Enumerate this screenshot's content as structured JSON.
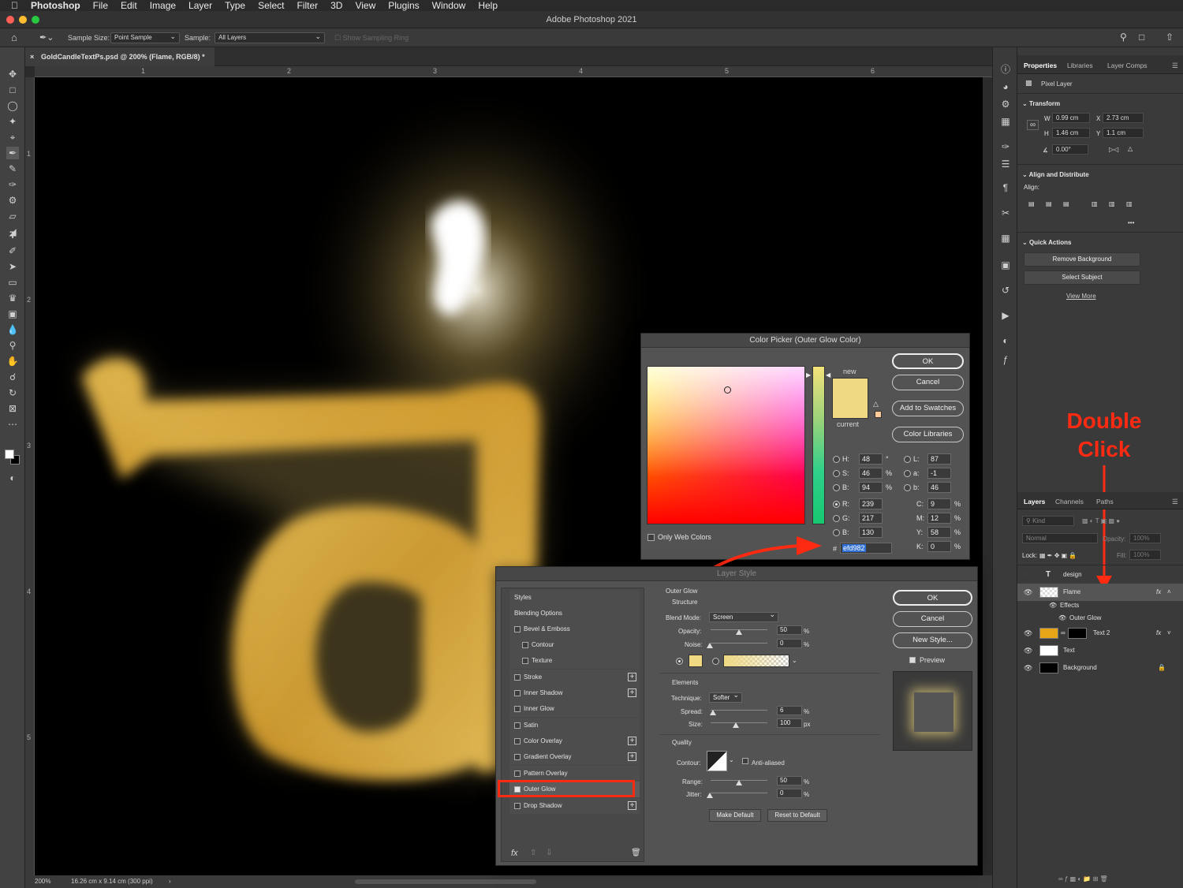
{
  "menubar": {
    "app": "Photoshop",
    "items": [
      "File",
      "Edit",
      "Image",
      "Layer",
      "Type",
      "Select",
      "Filter",
      "3D",
      "View",
      "Plugins",
      "Window",
      "Help"
    ]
  },
  "window_title": "Adobe Photoshop 2021",
  "options": {
    "sample_size_label": "Sample Size:",
    "sample_size_value": "Point Sample",
    "sample_label": "Sample:",
    "sample_value": "All Layers",
    "show_ring": "Show Sampling Ring"
  },
  "document": {
    "tab_title": "GoldCandleTextPs.psd @ 200% (Flame, RGB/8) *",
    "ruler_h": [
      "1",
      "2",
      "3",
      "4",
      "5",
      "6"
    ],
    "ruler_v": [
      "1",
      "2",
      "3",
      "4",
      "5"
    ],
    "zoom": "200%",
    "doc_size": "16.26 cm x 9.14 cm (300 ppi)",
    "status_arrow": "›"
  },
  "properties": {
    "tabs": [
      "Properties",
      "Libraries",
      "Layer Comps"
    ],
    "pixel_layer": "Pixel Layer",
    "transform_title": "Transform",
    "w_label": "W",
    "w": "0.99 cm",
    "x_label": "X",
    "x": "2.73 cm",
    "h_label": "H",
    "h": "1.46 cm",
    "y_label": "Y",
    "y": "1.1 cm",
    "angle": "0.00°",
    "align_title": "Align and Distribute",
    "align_label": "Align:",
    "more": "•••",
    "quick_title": "Quick Actions",
    "remove_bg": "Remove Background",
    "select_subject": "Select Subject",
    "view_more": "View More"
  },
  "layers_panel": {
    "tabs": [
      "Layers",
      "Channels",
      "Paths"
    ],
    "kind_placeholder": "Kind",
    "blend": "Normal",
    "opacity_label": "Opacity:",
    "opacity": "100%",
    "lock_label": "Lock:",
    "fill_label": "Fill:",
    "fill": "100%",
    "layers": [
      {
        "name": "design",
        "type": "text"
      },
      {
        "name": "Flame",
        "fx": "fx"
      },
      {
        "name": "Effects"
      },
      {
        "name": "Outer Glow"
      },
      {
        "name": "Text 2",
        "fx": "fx"
      },
      {
        "name": "Text"
      },
      {
        "name": "Background"
      }
    ]
  },
  "annotation": {
    "line1": "Double",
    "line2": "Click",
    "color": "#ff2a12"
  },
  "color_picker": {
    "title": "Color Picker (Outer Glow Color)",
    "ok": "OK",
    "cancel": "Cancel",
    "add_swatches": "Add to Swatches",
    "color_libraries": "Color Libraries",
    "new_label": "new",
    "current_label": "current",
    "new_color": "#efd982",
    "current_color": "#efd982",
    "h_label": "H:",
    "h": "48",
    "h_unit": "°",
    "s_label": "S:",
    "s": "46",
    "s_unit": "%",
    "b_label": "B:",
    "b": "94",
    "b_unit": "%",
    "r_label": "R:",
    "r": "239",
    "g_label": "G:",
    "g": "217",
    "bl_label": "B:",
    "bl": "130",
    "l_label": "L:",
    "l": "87",
    "a_label": "a:",
    "a": "-1",
    "b2_label": "b:",
    "b2": "46",
    "c_label": "C:",
    "c": "9",
    "m_label": "M:",
    "m": "12",
    "yy_label": "Y:",
    "yy": "58",
    "k_label": "K:",
    "k": "0",
    "pct": "%",
    "hash": "#",
    "hex": "efd982",
    "only_web": "Only Web Colors"
  },
  "layer_style": {
    "title": "Layer Style",
    "styles_list": [
      {
        "label": "Styles",
        "cb": false,
        "plus": false,
        "checked": false
      },
      {
        "label": "Blending Options",
        "cb": false,
        "plus": false,
        "checked": false
      },
      {
        "label": "Bevel & Emboss",
        "cb": true,
        "plus": false,
        "checked": false
      },
      {
        "label": "Contour",
        "cb": true,
        "plus": false,
        "checked": false,
        "indent": true
      },
      {
        "label": "Texture",
        "cb": true,
        "plus": false,
        "checked": false,
        "indent": true
      },
      {
        "label": "Stroke",
        "cb": true,
        "plus": true,
        "checked": false
      },
      {
        "label": "Inner Shadow",
        "cb": true,
        "plus": true,
        "checked": false
      },
      {
        "label": "Inner Glow",
        "cb": true,
        "plus": false,
        "checked": false
      },
      {
        "label": "Satin",
        "cb": true,
        "plus": false,
        "checked": false
      },
      {
        "label": "Color Overlay",
        "cb": true,
        "plus": true,
        "checked": false
      },
      {
        "label": "Gradient Overlay",
        "cb": true,
        "plus": true,
        "checked": false
      },
      {
        "label": "Pattern Overlay",
        "cb": true,
        "plus": false,
        "checked": false
      },
      {
        "label": "Outer Glow",
        "cb": true,
        "plus": false,
        "checked": true
      },
      {
        "label": "Drop Shadow",
        "cb": true,
        "plus": true,
        "checked": false
      }
    ],
    "fx": "fx",
    "section": "Outer Glow",
    "structure": "Structure",
    "blend_mode_label": "Blend Mode:",
    "blend_mode": "Screen",
    "opacity_label": "Opacity:",
    "opacity": "50",
    "noise_label": "Noise:",
    "noise": "0",
    "pct": "%",
    "px": "px",
    "elements": "Elements",
    "technique_label": "Technique:",
    "technique": "Softer",
    "spread_label": "Spread:",
    "spread": "6",
    "size_label": "Size:",
    "size": "100",
    "quality": "Quality",
    "contour_label": "Contour:",
    "anti_aliased": "Anti-aliased",
    "range_label": "Range:",
    "range": "50",
    "jitter_label": "Jitter:",
    "jitter": "0",
    "make_default": "Make Default",
    "reset_default": "Reset to Default",
    "ok": "OK",
    "cancel": "Cancel",
    "new_style": "New Style...",
    "preview": "Preview",
    "glow_color": "#efd982"
  }
}
